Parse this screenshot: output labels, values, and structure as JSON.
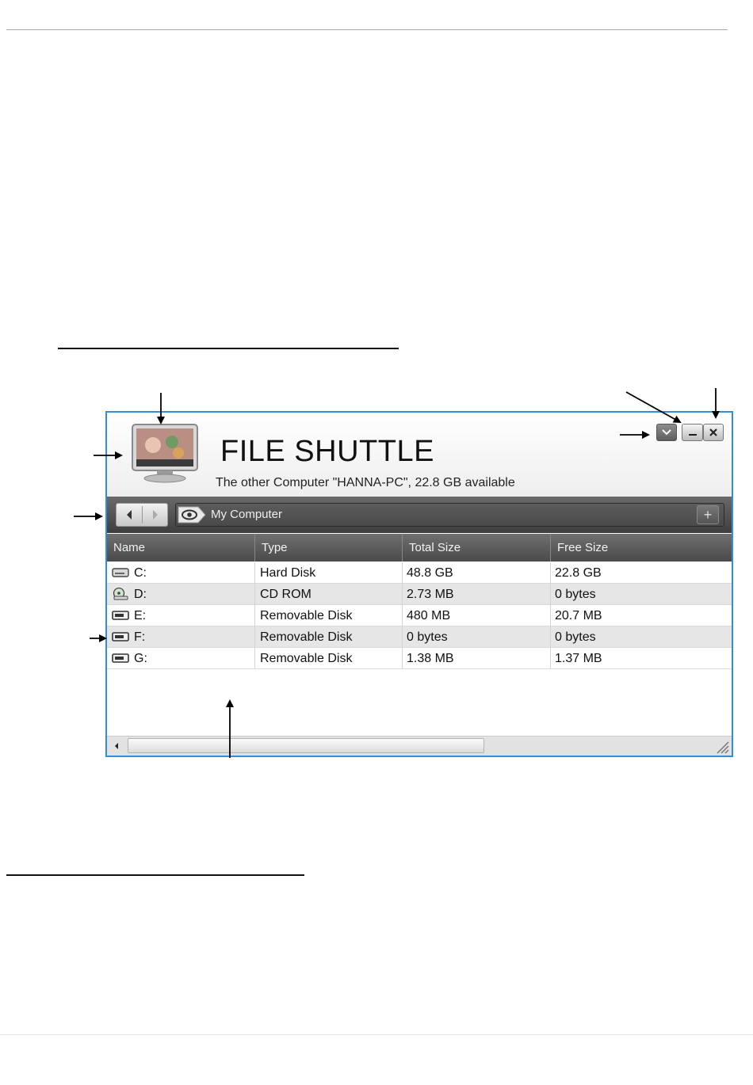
{
  "app": {
    "title": "FILE SHUTTLE",
    "subtitle": "The other Computer \"HANNA-PC\", 22.8 GB available"
  },
  "window_buttons": {
    "dropdown_icon": "chevron-down-icon",
    "minimize_icon": "minimize-icon",
    "close_icon": "close-icon"
  },
  "navigation": {
    "back_icon": "arrow-left-icon",
    "forward_icon": "arrow-right-icon",
    "view_icon": "eye-icon",
    "path": "My Computer",
    "add_icon": "plus-icon"
  },
  "table": {
    "columns": [
      "Name",
      "Type",
      "Total Size",
      "Free Size"
    ],
    "rows": [
      {
        "name": "C:",
        "icon": "hard-disk-icon",
        "type": "Hard Disk",
        "total": "48.8 GB",
        "free": "22.8 GB"
      },
      {
        "name": "D:",
        "icon": "cd-rom-icon",
        "type": "CD ROM",
        "total": "2.73 MB",
        "free": "0 bytes"
      },
      {
        "name": "E:",
        "icon": "removable-disk-icon",
        "type": "Removable Disk",
        "total": "480 MB",
        "free": "20.7 MB"
      },
      {
        "name": "F:",
        "icon": "removable-disk-icon",
        "type": "Removable Disk",
        "total": "0 bytes",
        "free": "0 bytes"
      },
      {
        "name": "G:",
        "icon": "removable-disk-icon",
        "type": "Removable Disk",
        "total": "1.38 MB",
        "free": "1.37 MB"
      }
    ]
  },
  "colors": {
    "window_border": "#2f8fd8",
    "toolbar_dark": "#4a4a4a",
    "row_alt": "#e6e6e6"
  }
}
